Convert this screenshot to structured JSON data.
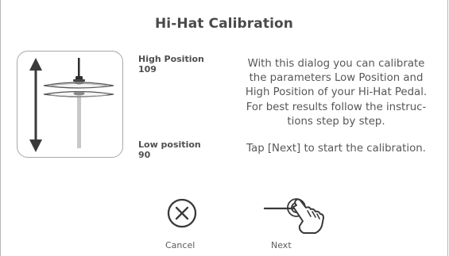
{
  "dialog": {
    "title": "Hi-Hat Calibration",
    "high_position": {
      "label": "High Position",
      "value": "109"
    },
    "low_position": {
      "label": "Low position",
      "value": "90"
    },
    "description": [
      "With this dialog you can calibrate",
      "the parameters Low Position and",
      "High Position of your Hi-Hat Pedal.",
      "For best results follow the instruc-",
      "tions step by step."
    ],
    "instruction": "Tap [Next] to start the calibration."
  },
  "buttons": {
    "cancel": {
      "label": "Cancel",
      "icon": "cancel-x-circle-icon"
    },
    "next": {
      "label": "Next",
      "icon": "tap-hand-icon"
    }
  },
  "illustration": {
    "icon": "hihat-range-icon"
  },
  "colors": {
    "text": "#505050",
    "border": "#a8a8a8",
    "icon": "#3a3a3a"
  }
}
